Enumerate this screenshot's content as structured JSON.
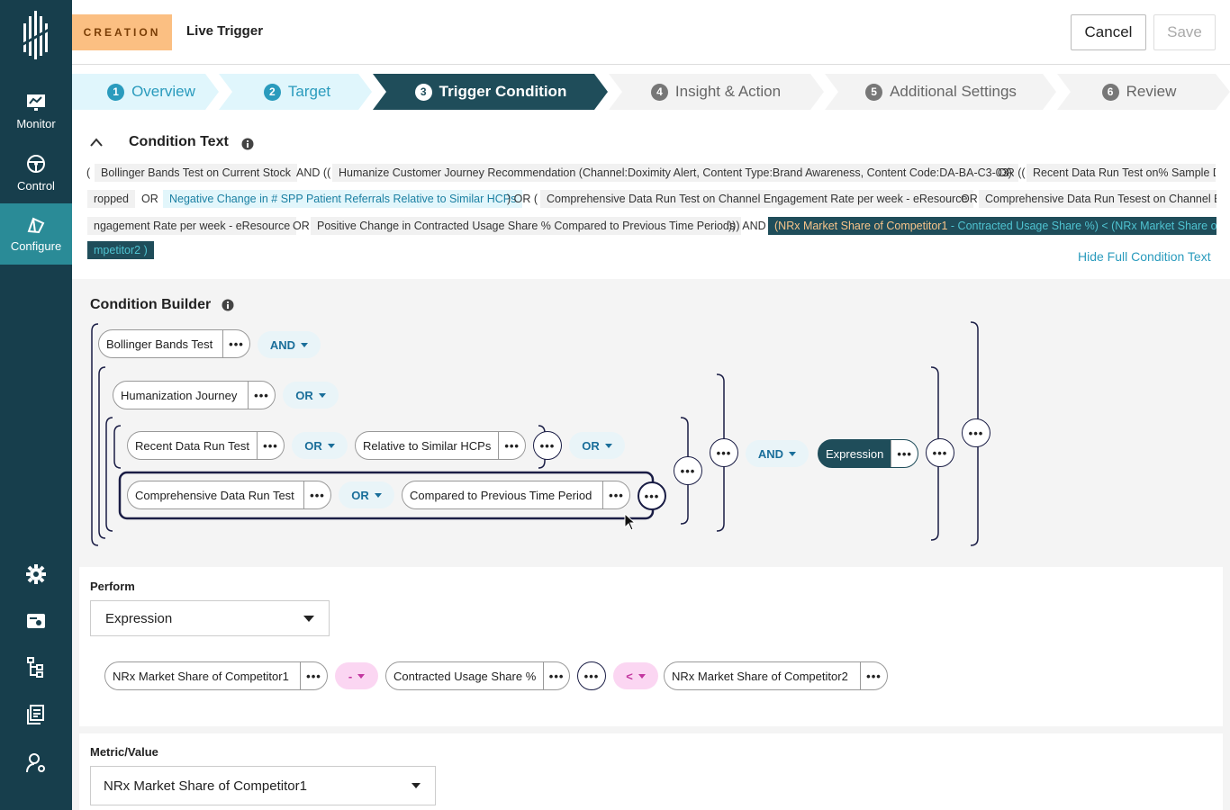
{
  "nav": {
    "logo": "logo-icon",
    "items": [
      {
        "label": "Monitor",
        "icon": "monitor-icon"
      },
      {
        "label": "Control",
        "icon": "steering-icon"
      },
      {
        "label": "Configure",
        "icon": "configure-icon"
      }
    ],
    "bottom_icons": [
      "gear-icon",
      "toggle-settings-icon",
      "hierarchy-icon",
      "documents-icon",
      "user-settings-icon"
    ]
  },
  "header": {
    "badge": "CREATION",
    "title": "Live Trigger",
    "cancel": "Cancel",
    "save": "Save"
  },
  "steps": [
    {
      "n": "1",
      "label": "Overview"
    },
    {
      "n": "2",
      "label": "Target"
    },
    {
      "n": "3",
      "label": "Trigger Condition"
    },
    {
      "n": "4",
      "label": "Insight & Action"
    },
    {
      "n": "5",
      "label": "Additional Settings"
    },
    {
      "n": "6",
      "label": "Review"
    }
  ],
  "condition_text": {
    "title": "Condition Text",
    "hide_link": "Hide Full Condition Text",
    "tokens": [
      "(",
      "Bollinger Bands Test on Current Stock",
      "AND ((",
      "Humanize Customer Journey Recommendation (Channel:Doximity Alert, Content Type:Brand Awareness, Content Code:DA-BA-C3-03)",
      "OR ((",
      "Recent Data Run Test on% Sample D",
      "ropped",
      "OR",
      "Negative Change in # SPP Patient Referrals Relative to Similar HCPs",
      ") OR (",
      "Comprehensive Data Run Test on Channel Engagement Rate per week - eResource",
      "OR",
      "Comprehensive Data Run Tesest on Channel E",
      "ngagement Rate per week - eResource",
      "OR",
      "Positive Change in Contracted Usage Share % Compared to Previous Time Periods",
      "))) AND",
      "(NRx Market Share of Competitor1",
      "- Contracted Usage Share %) < (NRx Market Share of Co",
      "mpetitor2 )"
    ]
  },
  "builder": {
    "title": "Condition Builder",
    "pills": {
      "p1": "Bollinger Bands Test",
      "p2": "Humanization Journey",
      "p3": "Recent Data Run Test",
      "p4": "Relative to Similar HCPs",
      "p5": "Comprehensive Data Run Test",
      "p6": "Compared to Previous Time Period",
      "p7": "Expression"
    },
    "ops": {
      "o1": "AND",
      "o2": "OR",
      "o3": "OR",
      "o4": "OR",
      "o5": "OR",
      "o6": "AND"
    },
    "more": "•••"
  },
  "perform": {
    "label": "Perform",
    "value": "Expression",
    "pills": {
      "e1": "NRx Market Share of Competitor1",
      "e2": "Contracted Usage Share %",
      "e3": "NRx Market Share of Competitor2"
    },
    "ops": {
      "m1": "-",
      "m2": "<"
    }
  },
  "metric": {
    "label": "Metric/Value",
    "value": "NRx Market Share of Competitor1"
  }
}
